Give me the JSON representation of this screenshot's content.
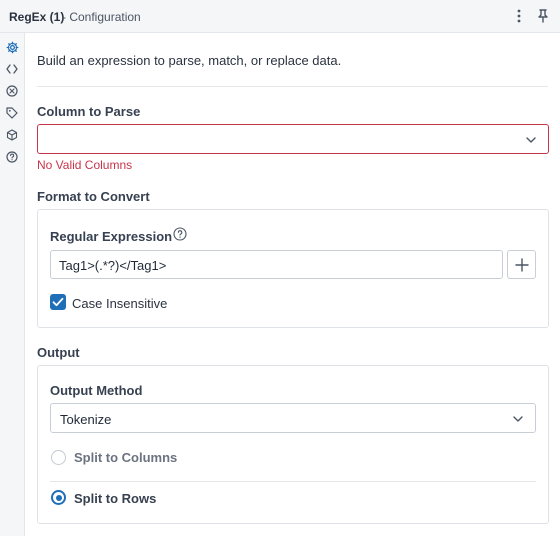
{
  "header": {
    "title": "RegEx (1)",
    "subtitle": "- Configuration",
    "more_icon": "vertical-ellipsis",
    "pin_icon": "pin"
  },
  "rail": {
    "icons": [
      "gear-icon",
      "code-icon",
      "annotation-icon",
      "tag-icon",
      "cube-icon",
      "help-icon"
    ],
    "active_color": "#1e6fb8"
  },
  "description": "Build an expression to parse, match, or replace data.",
  "column_to_parse": {
    "label": "Column to Parse",
    "value": "",
    "error": "No Valid Columns"
  },
  "format_to_convert": {
    "label": "Format to Convert",
    "regex_label": "Regular Expression",
    "regex_value": "Tag1>(.*?)</Tag1>",
    "case_insensitive_label": "Case Insensitive",
    "case_insensitive_checked": true
  },
  "output": {
    "label": "Output",
    "method_label": "Output Method",
    "method_value": "Tokenize",
    "options": [
      {
        "label": "Split to Columns",
        "selected": false
      },
      {
        "label": "Split to Rows",
        "selected": true
      }
    ]
  },
  "colors": {
    "accent": "#1e6fb8",
    "error": "#c8344a"
  }
}
